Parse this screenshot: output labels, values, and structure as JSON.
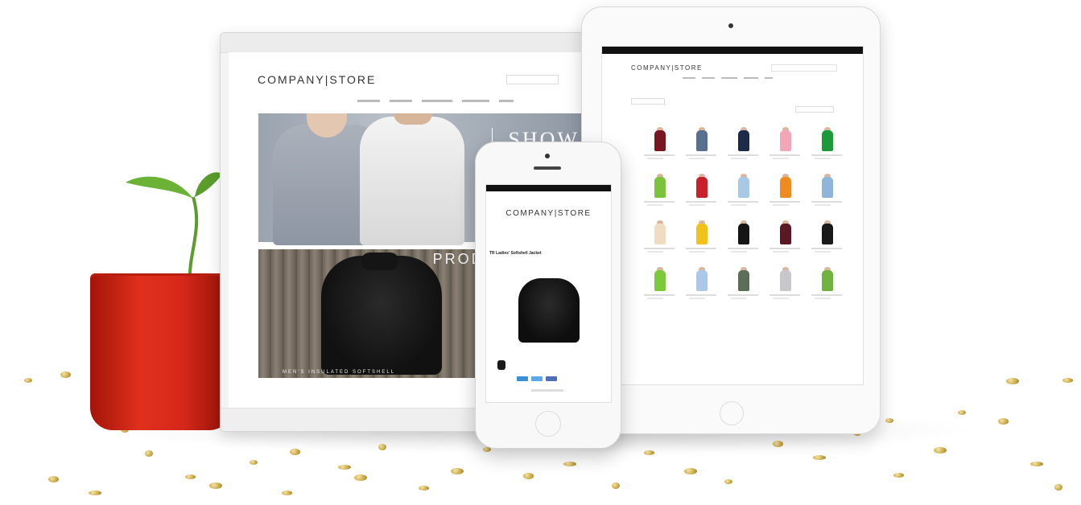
{
  "desktop": {
    "logo": "COMPANY|STORE",
    "hero_1_text": "SHOW",
    "hero_2_text": "PRODU OF T MON",
    "hero_2_caption": "MEN'S INSULATED SOFTSHELL"
  },
  "tablet": {
    "logo": "COMPANY|STORE"
  },
  "phone": {
    "logo": "COMPANY|STORE",
    "product_title": "TR Ladies' Softshell Jacket"
  },
  "colors": {
    "pot": "#d6281a",
    "leaf": "#5a9d2c",
    "confetti": "#c9a745"
  },
  "tablet_products": [
    {
      "color": "#7a1522"
    },
    {
      "color": "#57708f"
    },
    {
      "color": "#1d2a4a"
    },
    {
      "color": "#f2a6b8"
    },
    {
      "color": "#1b9a3a"
    },
    {
      "color": "#7cc23c"
    },
    {
      "color": "#c9212b"
    },
    {
      "color": "#a8c9e6"
    },
    {
      "color": "#f08a1e"
    },
    {
      "color": "#8fb6da"
    },
    {
      "color": "#f1dcc2"
    },
    {
      "color": "#f3c21a"
    },
    {
      "color": "#151515"
    },
    {
      "color": "#5b1723"
    },
    {
      "color": "#1a1a1a"
    },
    {
      "color": "#7cc93c"
    },
    {
      "color": "#a9c8ea"
    },
    {
      "color": "#5d6e58"
    },
    {
      "color": "#c8c8cc"
    },
    {
      "color": "#6fb23f"
    }
  ]
}
